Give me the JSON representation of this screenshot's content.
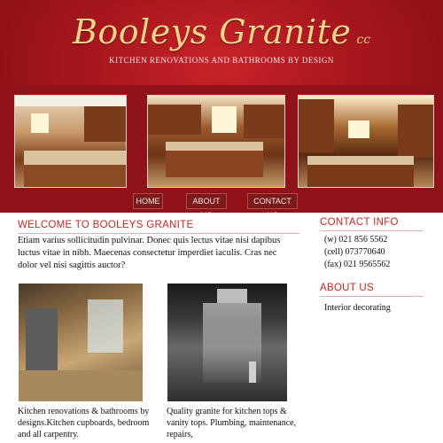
{
  "header": {
    "logo_main": "Booleys Granite",
    "logo_suffix": "cc",
    "tagline": "KITCHEN RENOVATIONS AND BATHROOMS BY DESIGN"
  },
  "nav": {
    "items": [
      {
        "label": "HOME"
      },
      {
        "label": "ABOUT US"
      },
      {
        "label": "CONTACT US"
      }
    ]
  },
  "welcome": {
    "heading": "WELCOME TO BOOLEYS GRANITE",
    "intro": "Etiam varius sollicitudin pulvinar. Donec quis lectus vitae nisi dapibus luctus vitae in nibh. Maecenas consectetur imperdiet iaculis. Cras nec dolor vel nisi sagittis auctor?"
  },
  "features": [
    {
      "caption": "Kitchen renovations & bathrooms by designs.Kitchen cupboards, bedroom and all carpentry."
    },
    {
      "caption": "Quality granite for kitchen tops & vanity tops. Plumbing, maintenance, repairs,"
    }
  ],
  "contact": {
    "heading": "CONTACT INFO",
    "lines": [
      "(w) 021 856 5562",
      "(cell) 073770640",
      "(fax) 021 9565562"
    ]
  },
  "about": {
    "heading": "ABOUT US",
    "text": "Interior decorating"
  }
}
